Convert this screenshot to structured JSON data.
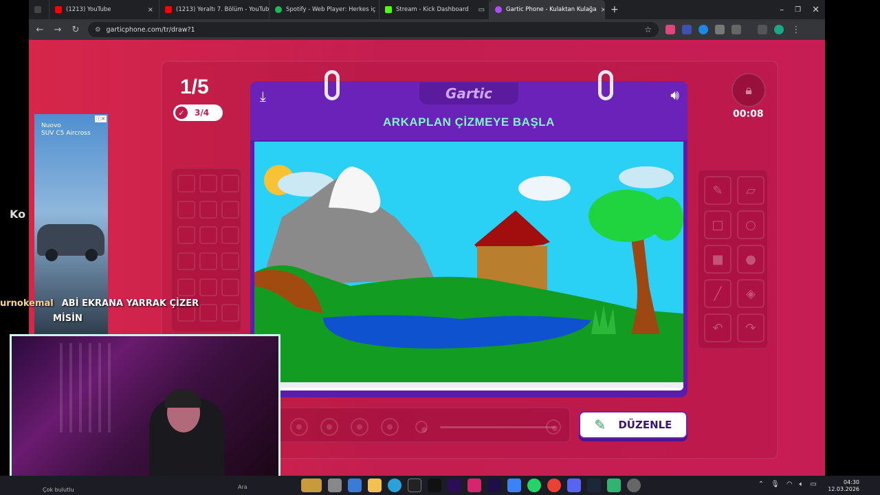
{
  "browser": {
    "tabs": [
      {
        "label": "(1213) YouTube",
        "color": "#ff0000"
      },
      {
        "label": "(1213) Yeraltı 7. Bölüm - YouTub",
        "color": "#ff0000"
      },
      {
        "label": "Spotify - Web Player: Herkes iç",
        "color": "#1db954"
      },
      {
        "label": "Stream - Kick Dashboard",
        "color": "#53fc18"
      },
      {
        "label": "",
        "color": "#8ab4f8"
      },
      {
        "label": "Gartic Phone - Kulaktan Kulağa",
        "color": "#b04aff"
      }
    ],
    "url": "garticphone.com/tr/draw?1"
  },
  "game": {
    "round": "1/5",
    "done_count": "3/4",
    "logo": "Gartic",
    "prompt": "ARKAPLAN ÇİZMEYE BAŞLA",
    "timer": "00:08",
    "edit_button": "DÜZENLE",
    "tools": [
      "pencil-icon",
      "eraser-icon",
      "rectangle-outline-icon",
      "circle-outline-icon",
      "rectangle-fill-icon",
      "circle-fill-icon",
      "line-icon",
      "fill-bucket-icon",
      "undo-icon",
      "redo-icon"
    ]
  },
  "ad": {
    "headline": "Nuovo",
    "subline": "SUV C5 Aircross"
  },
  "chat": {
    "user": "urnokemal",
    "message_line1": "ABİ EKRANA YARRAK ÇİZER",
    "message_line2": "MİSİN"
  },
  "edge_label": "Ko",
  "taskbar": {
    "weather": "Çok bulutlu",
    "search": "Ara",
    "time": "04:30",
    "date": "12.03.2026"
  },
  "colors": {
    "accent": "#6a22b8",
    "prompt_text": "#7ef7c8",
    "page_bg": "#d6264a"
  }
}
